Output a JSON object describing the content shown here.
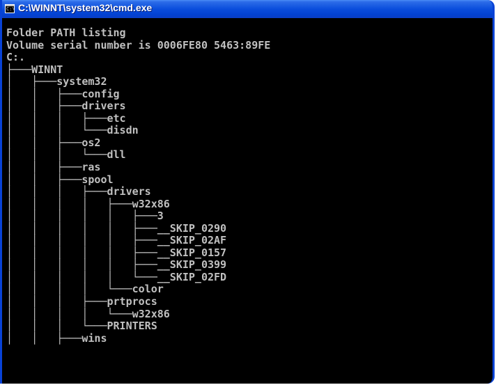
{
  "window": {
    "title": "C:\\WINNT\\system32\\cmd.exe",
    "icon": "console-window-icon",
    "icon_glyph": "C:\\"
  },
  "console": {
    "lines": [
      "Folder PATH listing",
      "Volume serial number is 0006FE80 5463:89FE",
      "C:.",
      "├───WINNT",
      "│   ├───system32",
      "│   │   ├───config",
      "│   │   ├───drivers",
      "│   │   │   ├───etc",
      "│   │   │   └───disdn",
      "│   │   ├───os2",
      "│   │   │   └───dll",
      "│   │   ├───ras",
      "│   │   ├───spool",
      "│   │   │   ├───drivers",
      "│   │   │   │   ├───w32x86",
      "│   │   │   │   │   ├───3",
      "│   │   │   │   │   ├───__SKIP_0290",
      "│   │   │   │   │   ├───__SKIP_02AF",
      "│   │   │   │   │   ├───__SKIP_0157",
      "│   │   │   │   │   ├───__SKIP_0399",
      "│   │   │   │   │   └───__SKIP_02FD",
      "│   │   │   │   └───color",
      "│   │   │   ├───prtprocs",
      "│   │   │   │   └───w32x86",
      "│   │   │   └───PRINTERS",
      "│   │   ├───wins"
    ]
  },
  "colors": {
    "titlebar": "#0a4ddc",
    "console_bg": "#000000",
    "console_text": "#c0c0c0"
  }
}
